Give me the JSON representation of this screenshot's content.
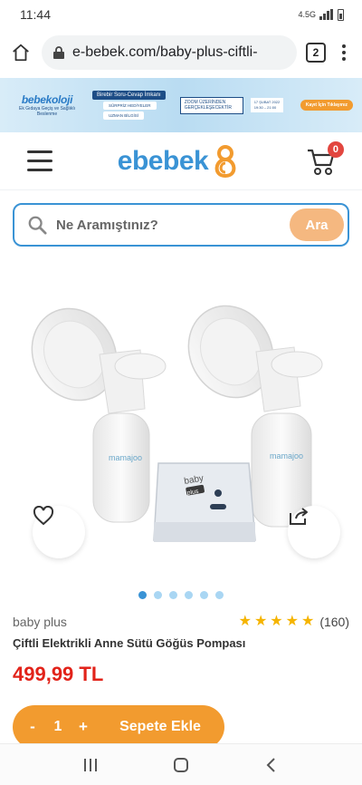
{
  "status_bar": {
    "time": "11:44",
    "network": "4.5G"
  },
  "browser": {
    "url": "e-bebek.com/baby-plus-ciftli-",
    "tab_count": "2"
  },
  "banner": {
    "brand": "bebekoloji",
    "subtitle": "Ek Gıdaya Geçiş ve Sağlıklı Beslenme",
    "headline": "Birebir Soru-Cevap İmkanı",
    "tag1": "SÜRPRİZ HEDİYELER",
    "tag2": "UZMAN BİLGİSİ",
    "zoom_text": "ZOOM ÜZERİNDEN GERÇEKLEŞECEKTİR",
    "date": "17 ŞUBAT 2022",
    "time": "19:30 – 21:00",
    "cta": "Kayıt İçin Tıklayınız"
  },
  "header": {
    "logo": "ebebek",
    "cart_count": "0"
  },
  "search": {
    "placeholder": "Ne Aramıştınız?",
    "button": "Ara"
  },
  "product": {
    "brand": "baby plus",
    "rating": 5,
    "stars": [
      "★",
      "★",
      "★",
      "★",
      "★"
    ],
    "review_count": "(160)",
    "title": "Çiftli Elektrikli Anne Sütü Göğüs Pompası",
    "price": "499,99 TL",
    "image_labels": {
      "bottle_brand": "mamajoo",
      "device_brand_top": "baby",
      "device_brand_bottom": "plus"
    },
    "gallery_count": 6,
    "gallery_active": 0
  },
  "cart_bar": {
    "minus": "-",
    "quantity": "1",
    "plus": "+",
    "add_label": "Sepete Ekle"
  },
  "colors": {
    "brand_blue": "#3a93d5",
    "accent_orange": "#f29b2f",
    "price_red": "#e2231a",
    "star_yellow": "#f5b400"
  }
}
